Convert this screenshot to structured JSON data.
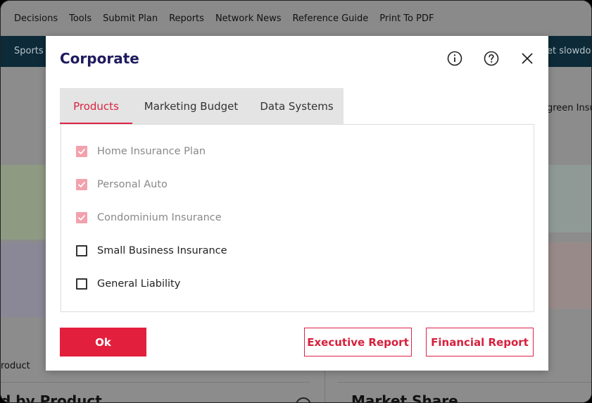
{
  "menubar": {
    "items": [
      "Decisions",
      "Tools",
      "Submit Plan",
      "Reports",
      "Network News",
      "Reference Guide",
      "Print To PDF"
    ]
  },
  "ticker": {
    "left_text": "Sports -",
    "right_text": "et slowdow"
  },
  "background": {
    "right_text": "green Insu",
    "product_text": "roduct",
    "bottom_left_heading": "d by Product",
    "bottom_mid_heading": "Market Share"
  },
  "modal": {
    "title": "Corporate",
    "tabs": [
      {
        "label": "Products",
        "active": true
      },
      {
        "label": "Marketing Budget",
        "active": false
      },
      {
        "label": "Data Systems",
        "active": false
      }
    ],
    "products": [
      {
        "label": "Home Insurance Plan",
        "checked": true,
        "disabled": true
      },
      {
        "label": "Personal Auto",
        "checked": true,
        "disabled": true
      },
      {
        "label": "Condominium Insurance",
        "checked": true,
        "disabled": true
      },
      {
        "label": "Small Business Insurance",
        "checked": false,
        "disabled": false
      },
      {
        "label": "General Liability",
        "checked": false,
        "disabled": false
      }
    ],
    "ok_label": "Ok",
    "executive_report_label": "Executive Report",
    "financial_report_label": "Financial Report",
    "icons": {
      "info": "info-icon",
      "help": "help-icon",
      "close": "close-icon"
    }
  },
  "colors": {
    "accent": "#e21f3c",
    "title": "#1e1b5e",
    "checked_disabled": "#f2a1ad",
    "ticker_bg": "#0c2a38"
  }
}
